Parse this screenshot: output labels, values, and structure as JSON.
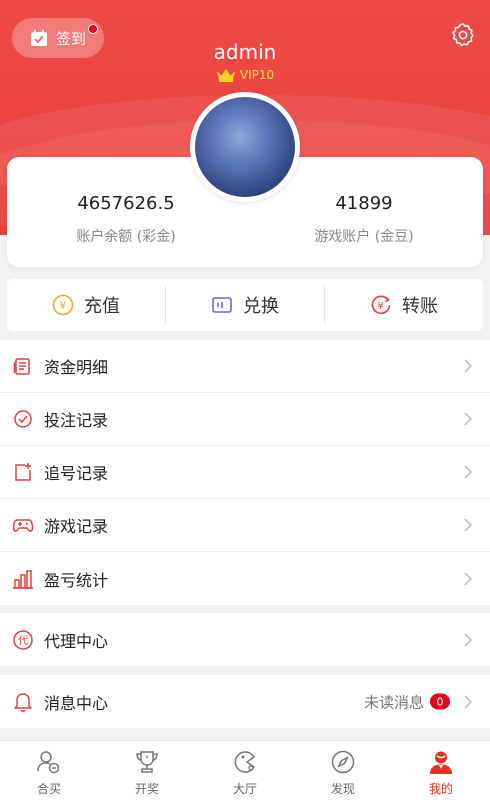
{
  "header": {
    "signin_label": "签到",
    "username": "admin",
    "vip_label": "VIP10"
  },
  "balances": {
    "account": {
      "value": "4657626.5",
      "label": "账户余额 (彩金)"
    },
    "game": {
      "value": "41899",
      "label": "游戏账户 (金豆)"
    }
  },
  "actions": [
    {
      "label": "充值",
      "icon": "yuan-coin-icon"
    },
    {
      "label": "兑换",
      "icon": "exchange-ticket-icon"
    },
    {
      "label": "转账",
      "icon": "transfer-icon"
    }
  ],
  "menu": {
    "group1": [
      {
        "label": "资金明细",
        "icon": "ledger-icon"
      },
      {
        "label": "投注记录",
        "icon": "bet-record-icon"
      },
      {
        "label": "追号记录",
        "icon": "chase-record-icon"
      },
      {
        "label": "游戏记录",
        "icon": "gamepad-icon"
      },
      {
        "label": "盈亏统计",
        "icon": "bar-chart-icon"
      }
    ],
    "group2": [
      {
        "label": "代理中心",
        "icon": "agent-icon"
      }
    ],
    "group3": [
      {
        "label": "消息中心",
        "icon": "bell-icon",
        "unread_label": "未读消息",
        "unread_count": "0"
      }
    ]
  },
  "tabbar": [
    {
      "label": "合买",
      "icon": "group-buy-icon",
      "active": false
    },
    {
      "label": "开奖",
      "icon": "trophy-icon",
      "active": false
    },
    {
      "label": "大厅",
      "icon": "lobby-icon",
      "active": false
    },
    {
      "label": "发现",
      "icon": "compass-icon",
      "active": false
    },
    {
      "label": "我的",
      "icon": "profile-icon",
      "active": true
    }
  ],
  "colors": {
    "brand_red": "#e83f3c",
    "active_tab": "#e5321f",
    "vip_gold": "#ffe14a",
    "badge_red": "#e5001b"
  }
}
